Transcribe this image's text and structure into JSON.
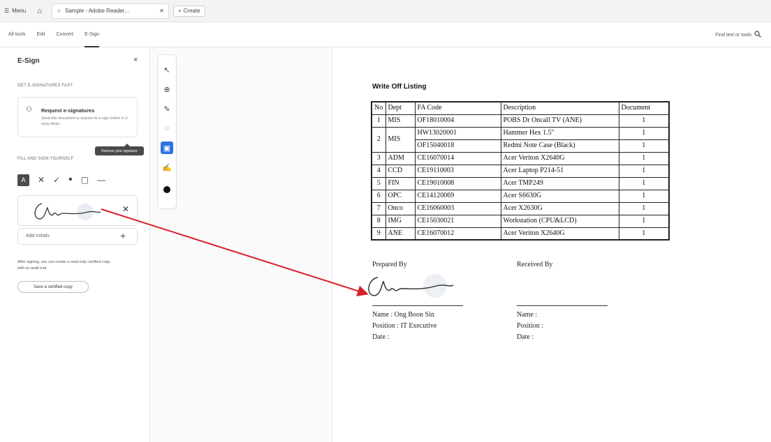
{
  "tabbar": {
    "menu_label": "Menu",
    "tab_title": "Sample - Adobe Reader...",
    "new_tab_label": "Create"
  },
  "menubar": {
    "items": [
      "All tools",
      "Edit",
      "Convert",
      "E-Sign"
    ],
    "active": "E-Sign",
    "find_placeholder": "Find text or tools"
  },
  "panel": {
    "title": "E-Sign",
    "section_fast": "GET E-SIGNATURES FAST",
    "request_title": "Request e-signatures",
    "request_desc": "Send this document to anyone to e-sign online in 3 easy steps",
    "section_fill": "FILL AND SIGN YOURSELF",
    "tooltip": "Remove your signature",
    "add_initials": "Add initials",
    "after_text": "After signing, you can create a read-only certified copy with an audit trail.",
    "certified_button": "Save a certified copy"
  },
  "document": {
    "title": "Write Off Listing",
    "table": {
      "headers": [
        "No",
        "Dept",
        "FA Code",
        "Description",
        "Document"
      ],
      "rows": [
        {
          "no": "1",
          "dept": "MIS",
          "items": [
            {
              "fa": "OF18010004",
              "desc": "POBS Dr Oncall TV (ANE)",
              "doc": "1"
            }
          ]
        },
        {
          "no": "2",
          "dept": "MIS",
          "items": [
            {
              "fa": "HW13020001",
              "desc": "Hammer Hex 1.5\"",
              "doc": "1"
            },
            {
              "fa": "OF15040018",
              "desc": "Redmi Note Case (Black)",
              "doc": "1"
            }
          ]
        },
        {
          "no": "3",
          "dept": "ADM",
          "items": [
            {
              "fa": "CE16070014",
              "desc": "Acer Veriton X2640G",
              "doc": "1"
            }
          ]
        },
        {
          "no": "4",
          "dept": "CCD",
          "items": [
            {
              "fa": "CE19110003",
              "desc": "Acer Laptop P214-51",
              "doc": "1"
            }
          ]
        },
        {
          "no": "5",
          "dept": "FIN",
          "items": [
            {
              "fa": "CE19010008",
              "desc": "Acer TMP249",
              "doc": "1"
            }
          ]
        },
        {
          "no": "6",
          "dept": "OPC",
          "items": [
            {
              "fa": "CE14120069",
              "desc": "Acer S6630G",
              "doc": "1"
            }
          ]
        },
        {
          "no": "7",
          "dept": "Onco",
          "items": [
            {
              "fa": "CE16060003",
              "desc": "Acer X2630G",
              "doc": "1"
            }
          ]
        },
        {
          "no": "8",
          "dept": "IMG",
          "items": [
            {
              "fa": "CE15030021",
              "desc": "Workstation (CPU&LCD)",
              "doc": "1"
            }
          ]
        },
        {
          "no": "9",
          "dept": "ANE",
          "items": [
            {
              "fa": "CE16070012",
              "desc": "Acer Veriton X2640G",
              "doc": "1"
            }
          ]
        }
      ]
    },
    "prepared": {
      "label": "Prepared By",
      "name": "Name : Ong Boon Sin",
      "position": "Position : IT Executive",
      "date": "Date :"
    },
    "received": {
      "label": "Received By",
      "name": "Name :",
      "position": "Position :",
      "date": "Date :"
    }
  },
  "colors": {
    "accent": "#2b72e0",
    "arrow": "#d9202a"
  }
}
